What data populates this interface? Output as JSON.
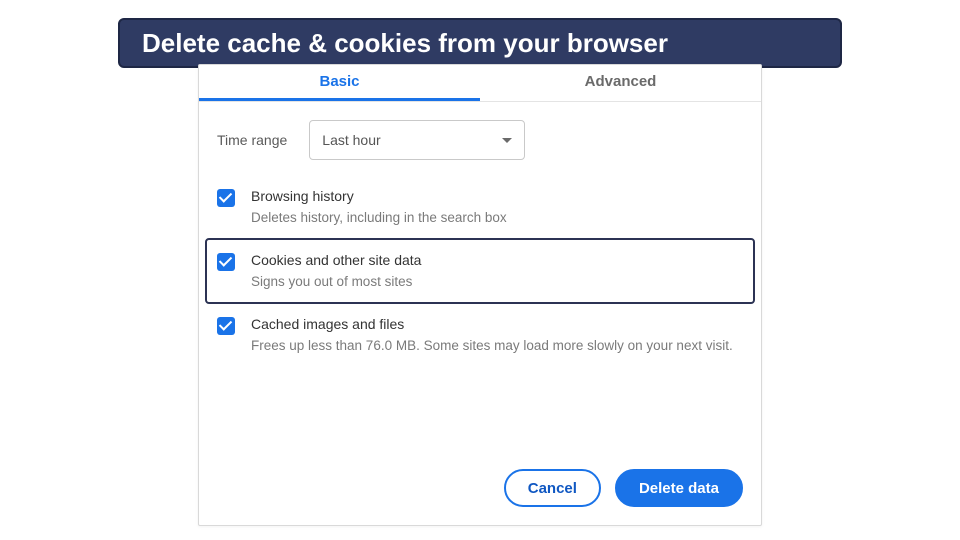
{
  "banner": {
    "title": "Delete cache & cookies from your browser"
  },
  "tabs": {
    "basic": "Basic",
    "advanced": "Advanced",
    "active": "basic"
  },
  "time_range": {
    "label": "Time range",
    "value": "Last hour"
  },
  "options": {
    "browsing_history": {
      "title": "Browsing history",
      "desc": "Deletes history, including in the search box",
      "checked": true
    },
    "cookies": {
      "title": "Cookies and other site data",
      "desc": "Signs you out of most sites",
      "checked": true,
      "highlighted": true
    },
    "cache": {
      "title": "Cached images and files",
      "desc": "Frees up less than 76.0 MB. Some sites may load more slowly on your next visit.",
      "checked": true
    }
  },
  "buttons": {
    "cancel": "Cancel",
    "delete": "Delete data"
  }
}
